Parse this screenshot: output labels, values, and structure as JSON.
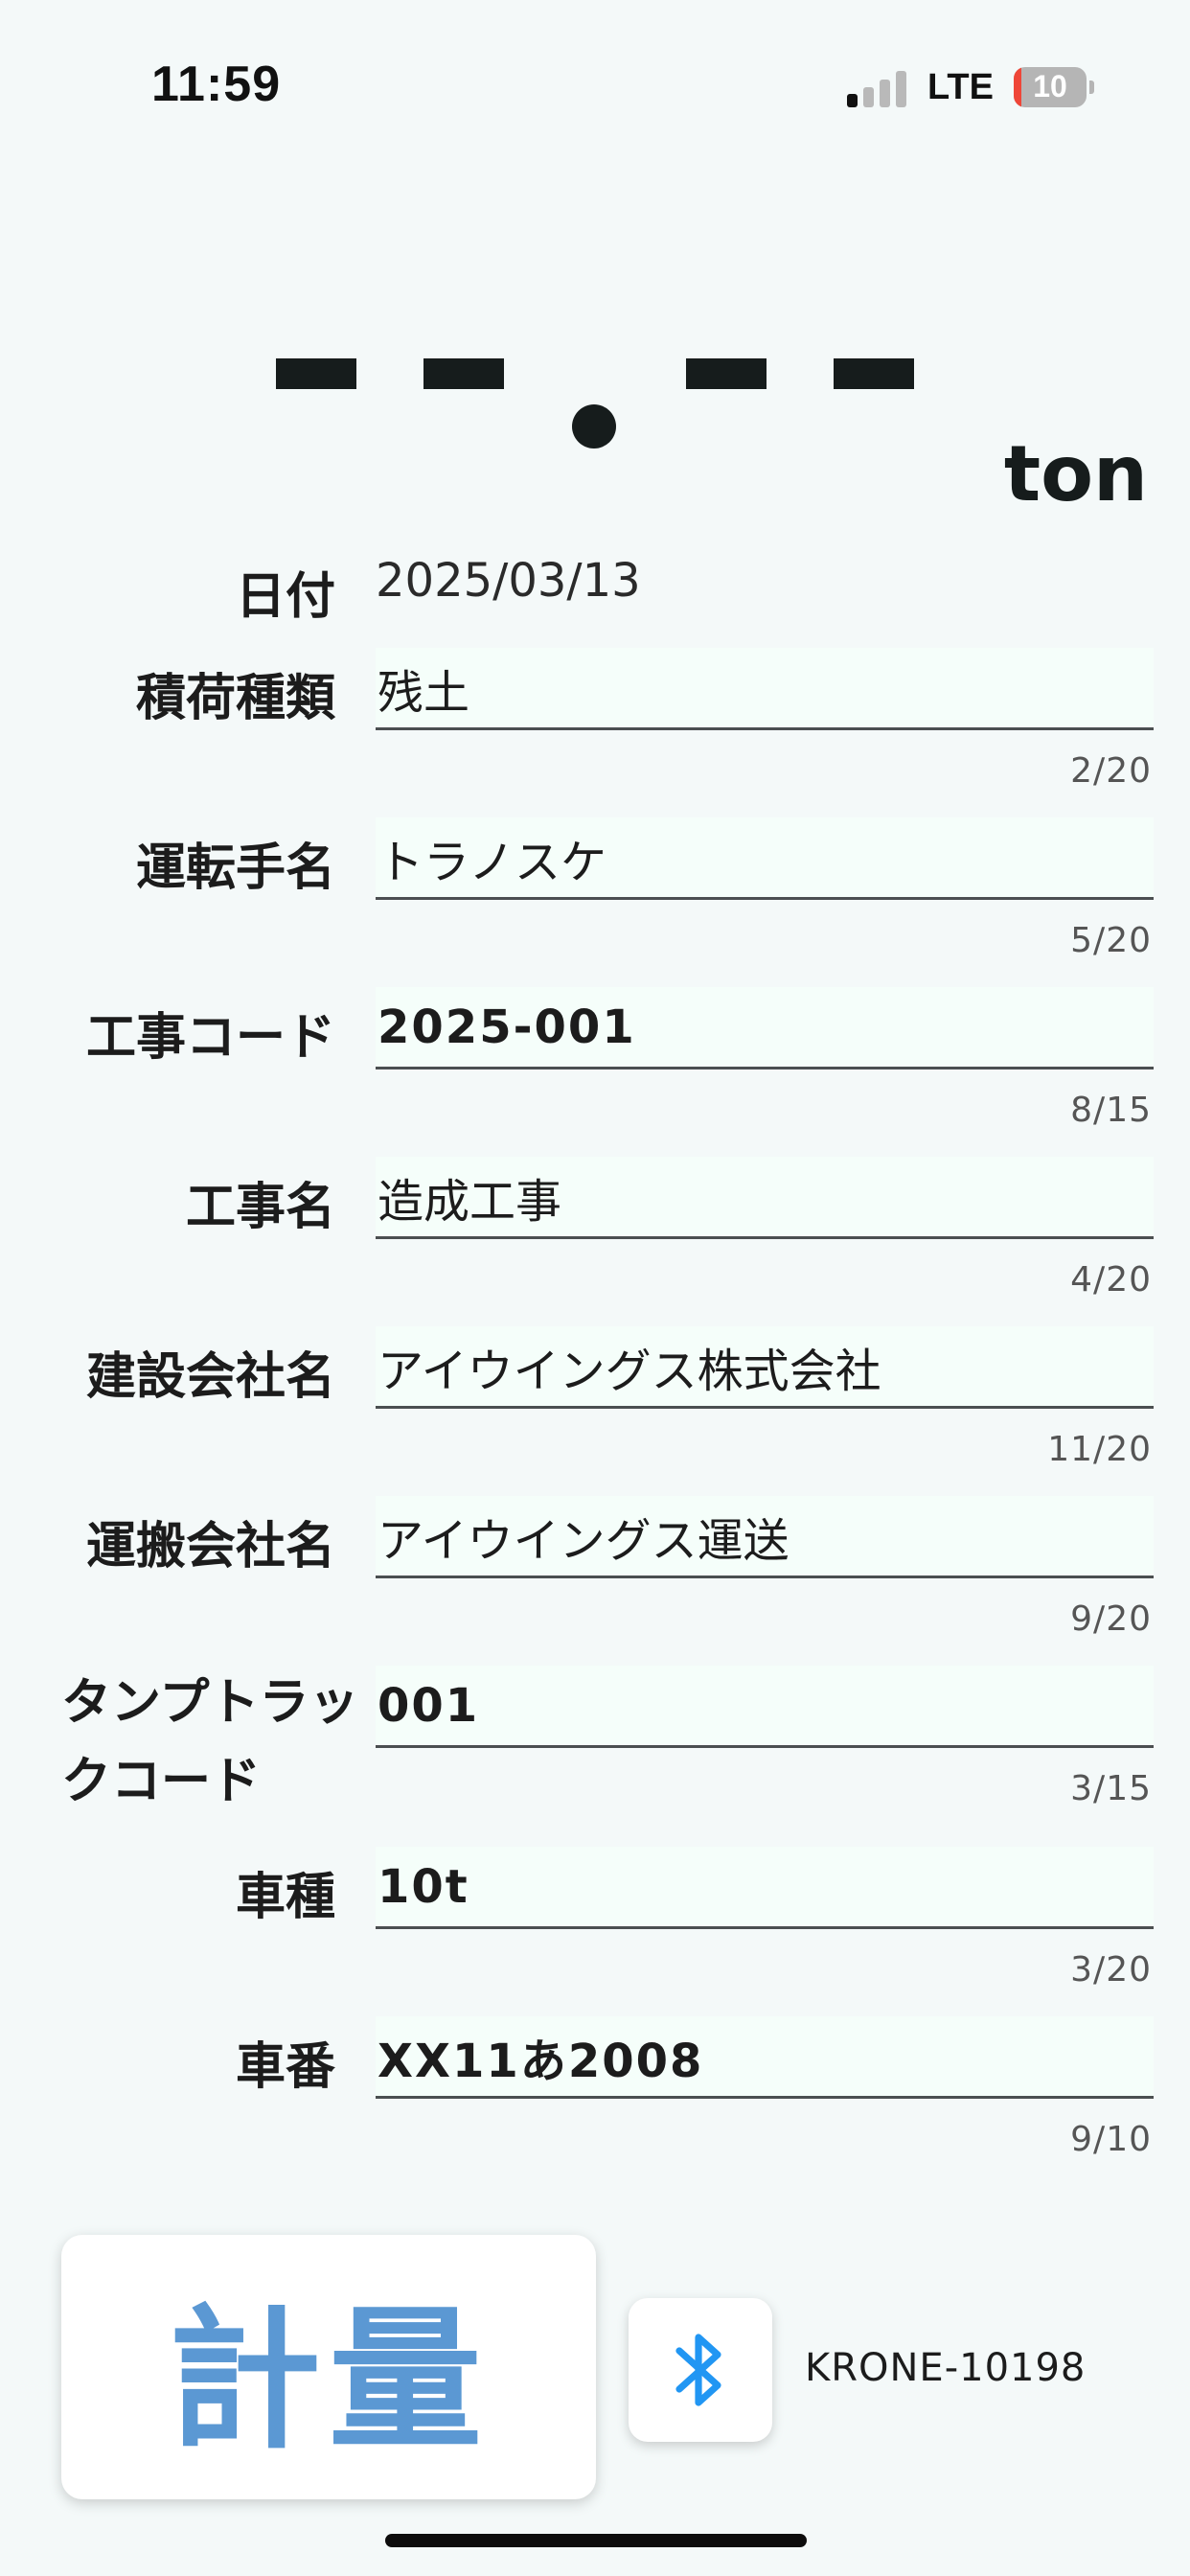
{
  "status_bar": {
    "time": "11:59",
    "network": "LTE",
    "battery": "10",
    "battery_level": 0.1
  },
  "weight_display": {
    "reading": "--.--",
    "unit": "ton"
  },
  "form": {
    "date": {
      "label": "日付",
      "value": "2025/03/13"
    },
    "fields": [
      {
        "label": "積荷種類",
        "value": "残土",
        "counter": "2/20",
        "bold": false
      },
      {
        "label": "運転手名",
        "value": "トラノスケ",
        "counter": "5/20",
        "bold": false
      },
      {
        "label": "工事コード",
        "value": "2025-001",
        "counter": "8/15",
        "bold": true
      },
      {
        "label": "工事名",
        "value": "造成工事",
        "counter": "4/20",
        "bold": false
      },
      {
        "label": "建設会社名",
        "value": "アイウイングス株式会社",
        "counter": "11/20",
        "bold": false
      },
      {
        "label": "運搬会社名",
        "value": "アイウイングス運送",
        "counter": "9/20",
        "bold": false
      },
      {
        "label": "タンプトラックコード",
        "value": "001",
        "counter": "3/15",
        "bold": true
      },
      {
        "label": "車種",
        "value": "10t",
        "counter": "3/20",
        "bold": true
      },
      {
        "label": "車番",
        "value": "XX11あ2008",
        "counter": "9/10",
        "bold": true
      }
    ]
  },
  "bottom": {
    "measure_label": "計量",
    "bluetooth_icon": "bluetooth-icon",
    "device_name": "KRONE-10198"
  },
  "colors": {
    "background": "#f4f9f9",
    "field_background": "#f5fefa",
    "accent_blue": "#5b98d3",
    "bluetooth_blue": "#2196f3",
    "battery_red": "#ef4638"
  }
}
